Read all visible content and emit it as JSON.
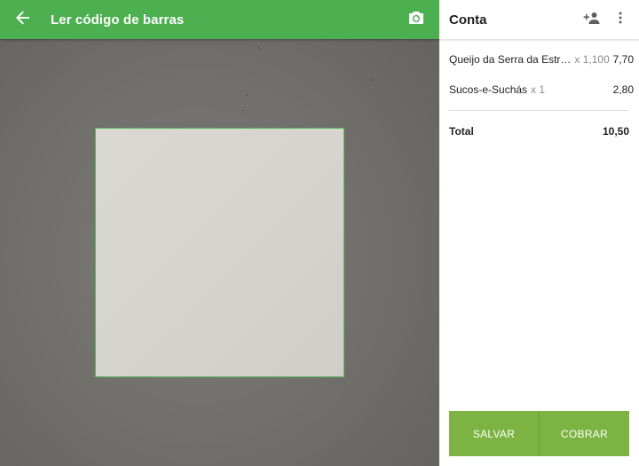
{
  "scanner": {
    "title": "Ler código de barras",
    "back_icon": "arrow-back-icon",
    "camera_icon": "switch-camera-icon"
  },
  "bill": {
    "title": "Conta",
    "add_person_icon": "add-person-icon",
    "more_icon": "more-vert-icon",
    "items": [
      {
        "name": "Queijo da Serra da Estr…",
        "qty": "x 1,100",
        "price": "7,70"
      },
      {
        "name": "Sucos-e-Suchás",
        "qty": "x 1",
        "price": "2,80"
      }
    ],
    "total_label": "Total",
    "total_value": "10,50",
    "save_label": "SALVAR",
    "charge_label": "COBRAR"
  },
  "colors": {
    "primary": "#4caf50",
    "action": "#7cb342"
  }
}
